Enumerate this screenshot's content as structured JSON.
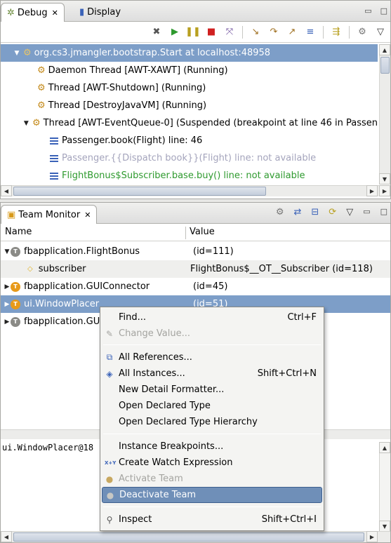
{
  "debug_view": {
    "tab_debug": "Debug",
    "tab_display": "Display",
    "tree": [
      {
        "text": "org.cs3.jmangler.bootstrap.Start at localhost:48958"
      },
      {
        "text": "Daemon Thread [AWT-XAWT] (Running)"
      },
      {
        "text": "Thread [AWT-Shutdown] (Running)"
      },
      {
        "text": "Thread [DestroyJavaVM] (Running)"
      },
      {
        "text": "Thread [AWT-EventQueue-0] (Suspended (breakpoint at line 46 in Passen"
      },
      {
        "text": "Passenger.book(Flight) line: 46"
      },
      {
        "text": "Passenger.{{Dispatch book}}(Flight) line: not available"
      },
      {
        "text": "FlightBonus$Subscriber.base.buy() line: not available"
      }
    ]
  },
  "team_monitor": {
    "tab_title": "Team Monitor",
    "col_name": "Name",
    "col_value": "Value",
    "rows": [
      {
        "name": "fbapplication.FlightBonus",
        "value": "(id=111)"
      },
      {
        "name": "subscriber",
        "value": "FlightBonus$__OT__Subscriber  (id=118)"
      },
      {
        "name": "fbapplication.GUIConnector",
        "value": "(id=45)"
      },
      {
        "name": "ui.WindowPlacer",
        "value": "(id=51)"
      },
      {
        "name": "fbapplication.GU",
        "value": ""
      }
    ],
    "detail_text": "ui.WindowPlacer@18"
  },
  "context_menu": {
    "find": "Find...",
    "find_acc": "Ctrl+F",
    "change_value": "Change Value...",
    "all_references": "All References...",
    "all_instances": "All Instances...",
    "all_instances_acc": "Shift+Ctrl+N",
    "new_detail_formatter": "New Detail Formatter...",
    "open_declared_type": "Open Declared Type",
    "open_declared_type_hierarchy": "Open Declared Type Hierarchy",
    "instance_breakpoints": "Instance Breakpoints...",
    "create_watch_expression": "Create Watch Expression",
    "watch_icon_label": "X+Y",
    "activate_team": "Activate Team",
    "deactivate_team": "Deactivate Team",
    "inspect": "Inspect",
    "inspect_acc": "Shift+Ctrl+I"
  }
}
